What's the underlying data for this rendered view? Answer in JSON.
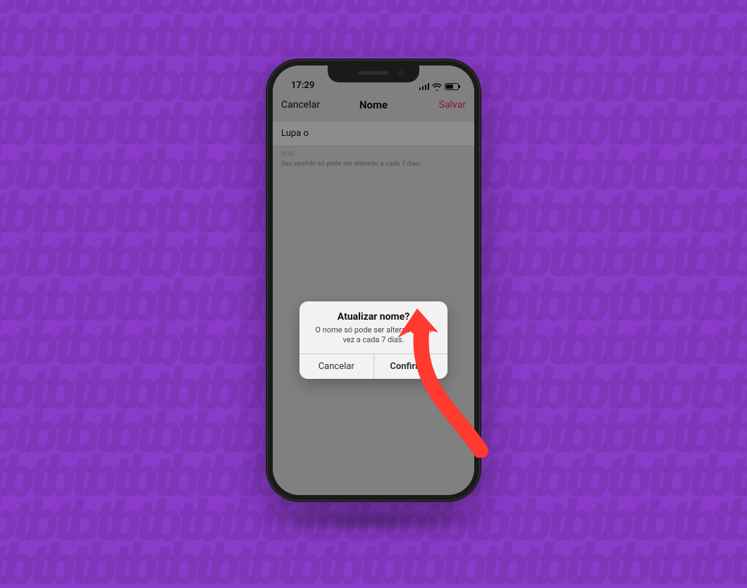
{
  "background": {
    "color": "#8a3bc9",
    "watermark_text": "tb"
  },
  "statusbar": {
    "time": "17:29"
  },
  "navbar": {
    "left": "Cancelar",
    "title": "Nome",
    "right": "Salvar"
  },
  "form": {
    "name_value": "Lupa o",
    "counter": "6/30",
    "hint": "Seu apelido só pode ser alterado a cada 7 dias."
  },
  "alert": {
    "title": "Atualizar nome?",
    "message": "O nome só pode ser alterado uma vez a cada 7 dias.",
    "cancel": "Cancelar",
    "confirm": "Confirmar"
  },
  "annotation": {
    "arrow_color": "#ff3a2f",
    "target": "alert-confirm-button"
  }
}
